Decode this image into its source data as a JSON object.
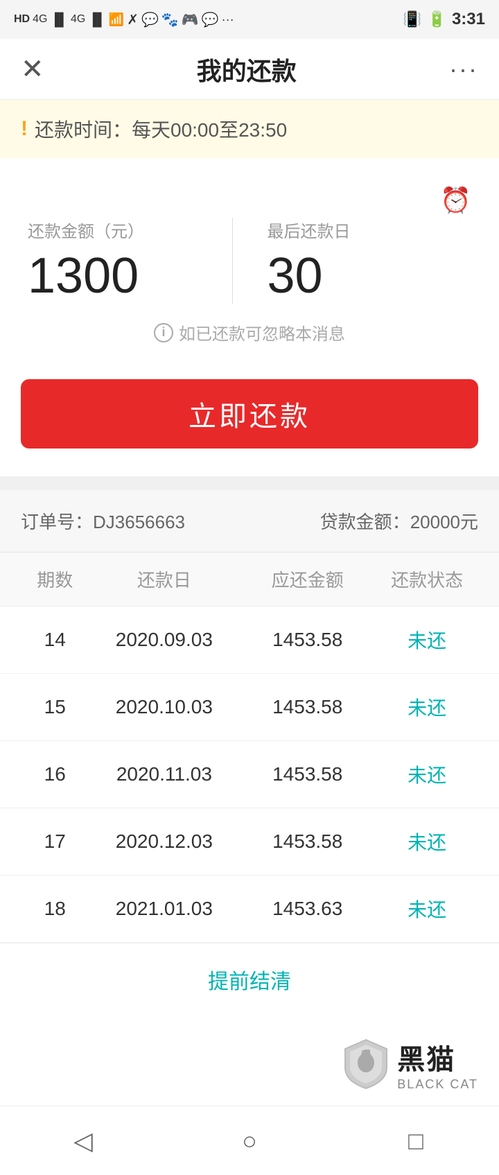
{
  "statusBar": {
    "time": "3:31"
  },
  "nav": {
    "closeLabel": "✕",
    "title": "我的还款",
    "moreLabel": "···"
  },
  "notice": {
    "icon": "!",
    "text": "还款时间：每天00:00至23:50"
  },
  "summary": {
    "amountLabel": "还款金额（元）",
    "amountValue": "1300",
    "dueDateLabel": "最后还款日",
    "dueDateValue": "30",
    "infoText": "如已还款可忽略本消息"
  },
  "payButton": {
    "label": "立即还款"
  },
  "order": {
    "orderNoLabel": "订单号：",
    "orderNo": "DJ3656663",
    "loanAmountLabel": "贷款金额：",
    "loanAmount": "20000元"
  },
  "table": {
    "headers": [
      "期数",
      "还款日",
      "应还金额",
      "还款状态"
    ],
    "rows": [
      {
        "period": "14",
        "date": "2020.09.03",
        "amount": "1453.58",
        "status": "未还"
      },
      {
        "period": "15",
        "date": "2020.10.03",
        "amount": "1453.58",
        "status": "未还"
      },
      {
        "period": "16",
        "date": "2020.11.03",
        "amount": "1453.58",
        "status": "未还"
      },
      {
        "period": "17",
        "date": "2020.12.03",
        "amount": "1453.58",
        "status": "未还"
      },
      {
        "period": "18",
        "date": "2021.01.03",
        "amount": "1453.63",
        "status": "未还"
      }
    ]
  },
  "earlySettle": {
    "label": "提前结清"
  },
  "logo": {
    "chinese": "黑猫",
    "english": "BLACK CAT"
  },
  "bottomNav": {
    "back": "◁",
    "home": "○",
    "recent": "□"
  }
}
